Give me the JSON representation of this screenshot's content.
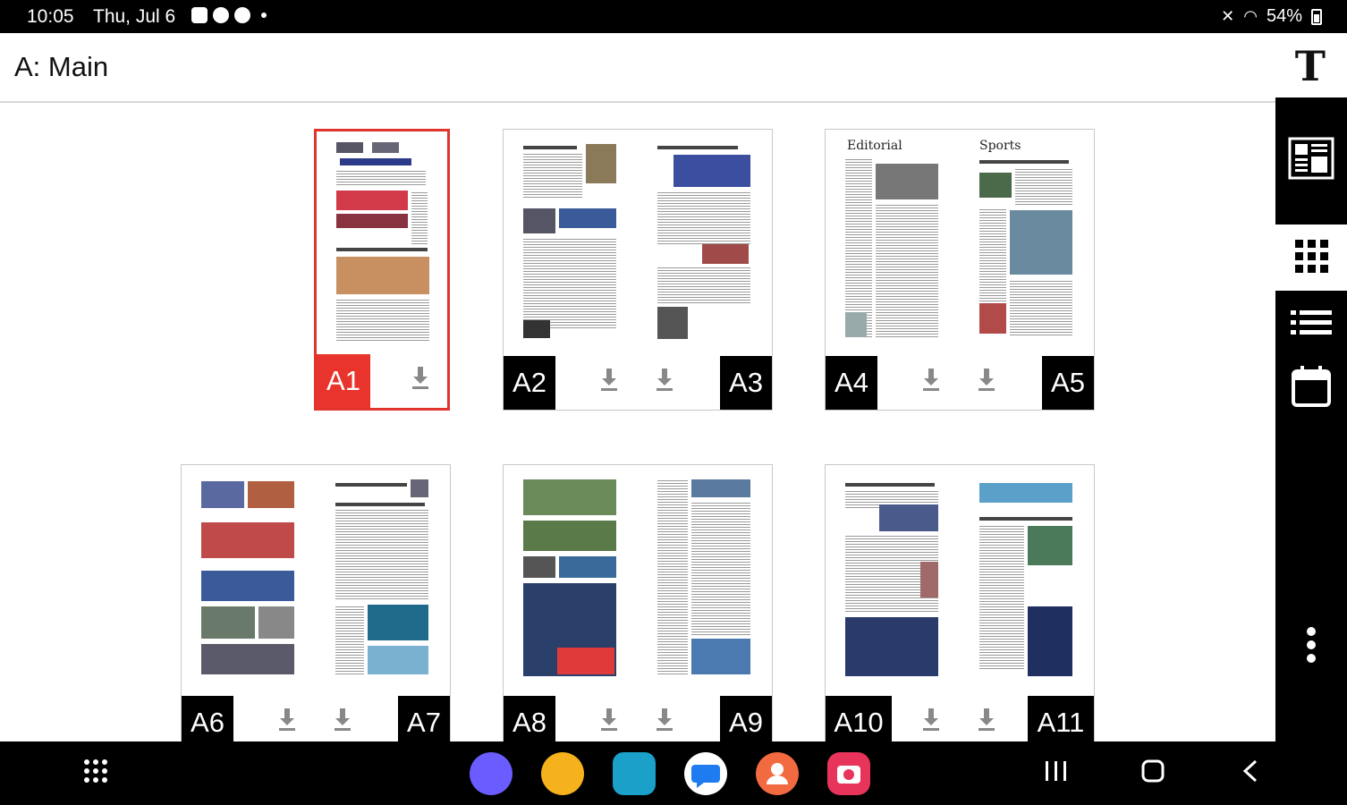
{
  "status_bar": {
    "time": "10:05",
    "date": "Thu, Jul 6",
    "battery": "54%"
  },
  "header": {
    "title": "A: Main",
    "text_size_button": "T"
  },
  "pages": {
    "a1": "A1",
    "a2": "A2",
    "a3": "A3",
    "a4": "A4",
    "a5": "A5",
    "a6": "A6",
    "a7": "A7",
    "a8": "A8",
    "a9": "A9",
    "a10": "A10",
    "a11": "A11"
  },
  "page_headers": {
    "editorial": "Editorial",
    "sports": "Sports"
  },
  "sidebar": {
    "icons": [
      "page-view-icon",
      "grid-view-icon",
      "list-view-icon",
      "calendar-icon",
      "more-icon"
    ],
    "active": "grid-view-icon"
  },
  "nav_bar": {
    "app_icons": [
      "internet-icon",
      "files-icon",
      "store-icon",
      "messages-icon",
      "contacts-icon",
      "camera-icon"
    ],
    "colors": {
      "internet": "#6a5cff",
      "files": "#f6b21c",
      "store": "#1aa0c9",
      "messages": "#1e7cf0",
      "contacts": "#f26a3f",
      "camera": "#e8345a"
    }
  },
  "colors": {
    "selected": "#e8342c",
    "label_bg": "#000000"
  }
}
